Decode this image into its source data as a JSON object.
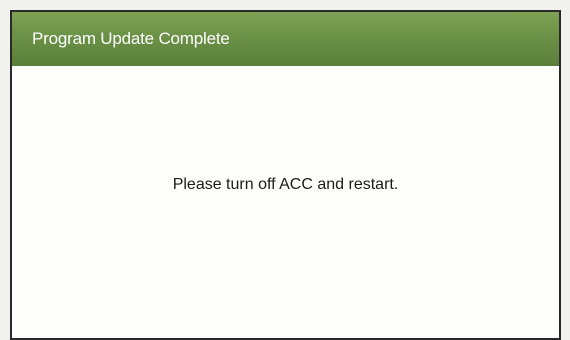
{
  "dialog": {
    "title": "Program Update Complete",
    "message": "Please turn off ACC and restart.",
    "title_bar_color": "#6b9146"
  }
}
